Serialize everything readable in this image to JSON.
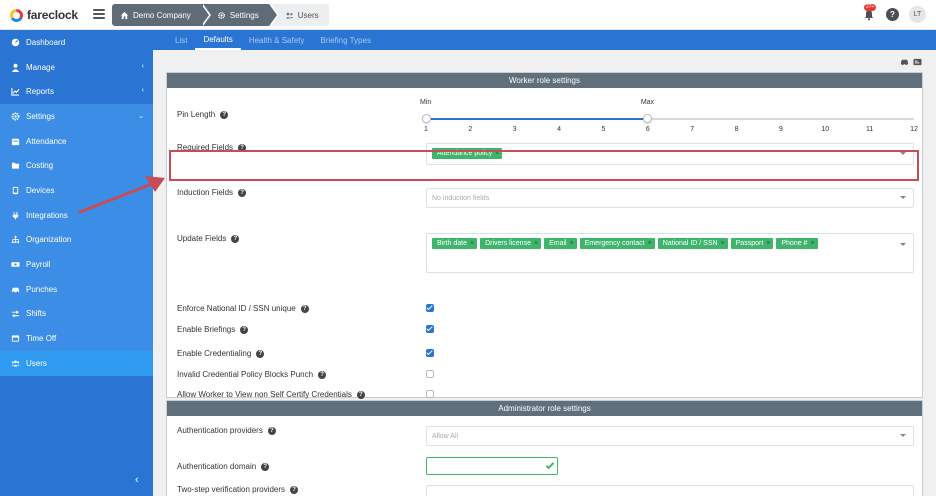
{
  "app": {
    "name": "fareclock"
  },
  "breadcrumb": [
    "Demo Company",
    "Settings",
    "Users"
  ],
  "header": {
    "notification_count": "27+",
    "help_label": "?",
    "avatar_initials": "LT"
  },
  "sidebar": {
    "items": [
      {
        "label": "Dashboard",
        "icon": "gauge-icon"
      },
      {
        "label": "Manage",
        "icon": "user-icon",
        "chevron": "‹"
      },
      {
        "label": "Reports",
        "icon": "line-chart-icon",
        "chevron": "‹"
      },
      {
        "label": "Settings",
        "icon": "gear-icon",
        "chevron": "⌄"
      },
      {
        "label": "Attendance",
        "icon": "calendar-icon"
      },
      {
        "label": "Costing",
        "icon": "folder-icon"
      },
      {
        "label": "Devices",
        "icon": "tablet-icon"
      },
      {
        "label": "Integrations",
        "icon": "plug-icon"
      },
      {
        "label": "Organization",
        "icon": "sitemap-icon"
      },
      {
        "label": "Payroll",
        "icon": "money-icon"
      },
      {
        "label": "Punches",
        "icon": "car-icon"
      },
      {
        "label": "Shifts",
        "icon": "shuffle-icon"
      },
      {
        "label": "Time Off",
        "icon": "plane-icon"
      },
      {
        "label": "Users",
        "icon": "users-icon"
      }
    ],
    "collapse_label": "‹"
  },
  "tabs": [
    "List",
    "Defaults",
    "Health & Safety",
    "Briefing Types"
  ],
  "worker": {
    "title": "Worker role settings",
    "pin_length_label": "Pin Length",
    "slider": {
      "min_label": "Min",
      "max_label": "Max",
      "ticks": [
        "1",
        "2",
        "3",
        "4",
        "5",
        "6",
        "7",
        "8",
        "9",
        "10",
        "11",
        "12"
      ],
      "min_value": 1,
      "max_value": 6,
      "range": [
        1,
        12
      ]
    },
    "required_fields_label": "Required Fields",
    "required_fields": [
      "Attendance policy"
    ],
    "induction_fields_label": "Induction Fields",
    "induction_placeholder": "No induction fields",
    "update_fields_label": "Update Fields",
    "update_fields": [
      "Birth date",
      "Drivers license",
      "Email",
      "Emergency contact",
      "National ID / SSN",
      "Passport",
      "Phone #"
    ],
    "options": [
      {
        "label": "Enforce National ID / SSN unique",
        "checked": true
      },
      {
        "label": "Enable Briefings",
        "checked": true
      },
      {
        "label": "Enable Credentialing",
        "checked": true
      },
      {
        "label": "Invalid Credential Policy Blocks Punch",
        "checked": false
      },
      {
        "label": "Allow Worker to View non Self Certify Credentials",
        "checked": false
      }
    ]
  },
  "admin": {
    "title": "Administrator role settings",
    "auth_providers_label": "Authentication providers",
    "auth_providers_placeholder": "Allow All",
    "auth_domain_label": "Authentication domain",
    "two_step_label": "Two-step verification providers"
  },
  "colors": {
    "brand": "#2a74d4",
    "chip": "#3fb56b",
    "highlight": "#c94b55",
    "panel_header": "#606f7c"
  }
}
